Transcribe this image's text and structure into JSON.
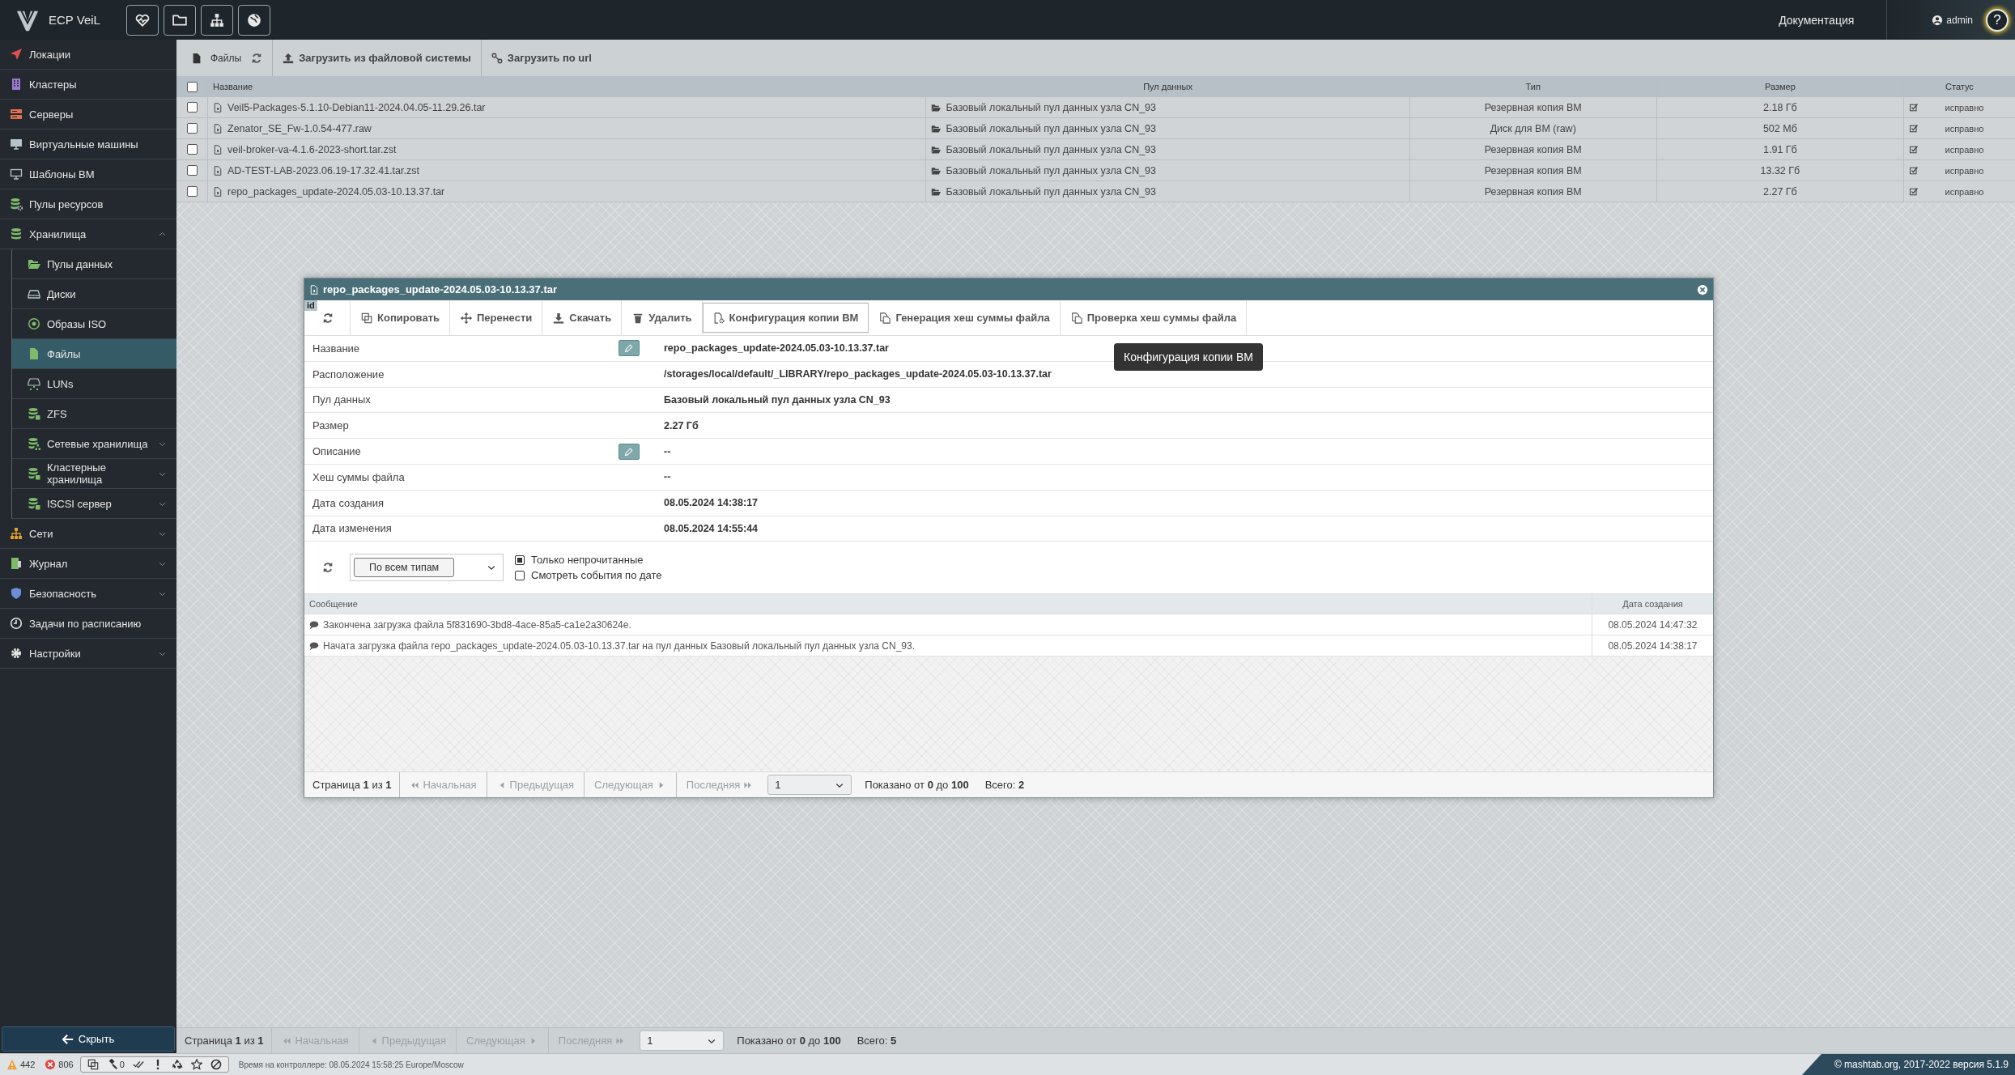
{
  "app": {
    "title": "ECP VeiL"
  },
  "top_buttons": [
    {
      "kind": "heart-pulse"
    },
    {
      "kind": "folder"
    },
    {
      "kind": "sitemap"
    },
    {
      "kind": "globe"
    }
  ],
  "header": {
    "docs_link": "Документация",
    "user": "admin",
    "help": "?"
  },
  "sidebar": {
    "items": [
      {
        "kind": "link",
        "label": "Локации",
        "selected": false
      },
      {
        "kind": "link",
        "label": "Кластеры",
        "selected": false
      },
      {
        "kind": "link",
        "label": "Серверы",
        "selected": false
      },
      {
        "kind": "link",
        "label": "Виртуальные машины",
        "selected": false
      },
      {
        "kind": "link",
        "label": "Шаблоны ВМ",
        "selected": false
      },
      {
        "kind": "link",
        "label": "Пулы ресурсов",
        "selected": false
      },
      {
        "kind": "group",
        "label": "Хранилища",
        "selected": false,
        "expanded": true,
        "children": [
          {
            "kind": "link",
            "label": "Пулы данных",
            "selected": false
          },
          {
            "kind": "link",
            "label": "Диски",
            "selected": false
          },
          {
            "kind": "link",
            "label": "Образы ISO",
            "selected": false
          },
          {
            "kind": "link",
            "label": "Файлы",
            "selected": true
          },
          {
            "kind": "link",
            "label": "LUNs",
            "selected": false
          },
          {
            "kind": "link",
            "label": "ZFS",
            "selected": false
          },
          {
            "kind": "group",
            "label": "Сетевые хранилища",
            "selected": false,
            "expanded": false
          },
          {
            "kind": "group",
            "label": "Кластерные хранилища",
            "selected": false,
            "expanded": false
          },
          {
            "kind": "group",
            "label": "ISCSI сервер",
            "selected": false,
            "expanded": false
          }
        ]
      },
      {
        "kind": "group",
        "label": "Сети",
        "selected": false,
        "expanded": false
      },
      {
        "kind": "group",
        "label": "Журнал",
        "selected": false,
        "expanded": false
      },
      {
        "kind": "group",
        "label": "Безопасность",
        "selected": false,
        "expanded": false
      },
      {
        "kind": "link",
        "label": "Задачи по расписанию",
        "selected": false
      },
      {
        "kind": "group",
        "label": "Настройки",
        "selected": false,
        "expanded": false
      }
    ],
    "hide_button": "Скрыть"
  },
  "toolbar": {
    "title": "Файлы",
    "buttons": [
      {
        "kind": "upload",
        "label": "Загрузить из файловой системы"
      },
      {
        "kind": "link",
        "label": "Загрузить по url"
      }
    ]
  },
  "table": {
    "all_checked": false,
    "columns": [
      "Название",
      "Пул данных",
      "Тип",
      "Размер",
      "Статус"
    ],
    "rows": [
      {
        "checked": false,
        "name": "Veil5-Packages-5.1.10-Debian11-2024.04.05-11.29.26.tar",
        "pool": "Базовый локальный пул данных узла CN_93",
        "type": "Резервная копия ВМ",
        "size": "2.18 Гб",
        "status": "исправно"
      },
      {
        "checked": false,
        "name": "Zenator_SE_Fw-1.0.54-477.raw",
        "pool": "Базовый локальный пул данных узла CN_93",
        "type": "Диск для ВМ (raw)",
        "size": "502 Мб",
        "status": "исправно"
      },
      {
        "checked": false,
        "name": "veil-broker-va-4.1.6-2023-short.tar.zst",
        "pool": "Базовый локальный пул данных узла CN_93",
        "type": "Резервная копия ВМ",
        "size": "1.91 Гб",
        "status": "исправно"
      },
      {
        "checked": false,
        "name": "AD-TEST-LAB-2023.06.19-17.32.41.tar.zst",
        "pool": "Базовый локальный пул данных узла CN_93",
        "type": "Резервная копия ВМ",
        "size": "13.32 Гб",
        "status": "исправно"
      },
      {
        "checked": false,
        "name": "repo_packages_update-2024.05.03-10.13.37.tar",
        "pool": "Базовый локальный пул данных узла CN_93",
        "type": "Резервная копия ВМ",
        "size": "2.27 Гб",
        "status": "исправно"
      }
    ]
  },
  "pagination": {
    "page_text": "Страница **1** из **1**",
    "buttons": [
      {
        "kind": "first",
        "label": "Начальная",
        "disabled": true
      },
      {
        "kind": "prev",
        "label": "Предыдущая",
        "disabled": true
      },
      {
        "kind": "next",
        "label": "Следующая",
        "disabled": true
      },
      {
        "kind": "last",
        "label": "Последняя",
        "disabled": true
      }
    ],
    "select": "1",
    "shown": "Показано от **0** до **100**",
    "total": "Всего: **5**"
  },
  "dialog": {
    "title": "repo_packages_update-2024.05.03-10.13.37.tar",
    "id_badge": "id",
    "actions": [
      {
        "kind": "refresh",
        "hovered": false
      },
      {
        "kind": "copy",
        "label": "Копировать",
        "hovered": false
      },
      {
        "kind": "move",
        "label": "Перенести",
        "hovered": false
      },
      {
        "kind": "download",
        "label": "Скачать",
        "hovered": false
      },
      {
        "kind": "trash",
        "label": "Удалить",
        "hovered": false
      },
      {
        "kind": "file-gear",
        "label": "Конфигурация копии ВМ",
        "hovered": true
      },
      {
        "kind": "file-copy",
        "label": "Генерация хеш суммы файла",
        "hovered": false
      },
      {
        "kind": "file-copy",
        "label": "Проверка хеш суммы файла",
        "hovered": false
      }
    ],
    "tooltip": "Конфигурация копии ВМ",
    "fields": [
      {
        "label": "Название",
        "value": "repo_packages_update-2024.05.03-10.13.37.tar",
        "editable": true
      },
      {
        "label": "Расположение",
        "value": "/storages/local/default/_LIBRARY/repo_packages_update-2024.05.03-10.13.37.tar",
        "editable": false
      },
      {
        "label": "Пул данных",
        "value": "Базовый локальный пул данных узла CN_93",
        "editable": false
      },
      {
        "label": "Размер",
        "value": "2.27 Гб",
        "editable": false
      },
      {
        "label": "Описание",
        "value": "--",
        "editable": true
      },
      {
        "label": "Хеш суммы файла",
        "value": "--",
        "editable": false
      },
      {
        "label": "Дата создания",
        "value": "08.05.2024 14:38:17",
        "editable": false
      },
      {
        "label": "Дата изменения",
        "value": "08.05.2024 14:55:44",
        "editable": false
      }
    ],
    "filter": {
      "select": "По всем типам",
      "checkboxes": [
        {
          "label": "Только непрочитанные",
          "checked": true
        },
        {
          "label": "Смотреть события по дате",
          "checked": false
        }
      ]
    },
    "events": {
      "columns": [
        "Сообщение",
        "Дата создания"
      ],
      "rows": [
        {
          "message": "Закончена загрузка файла 5f831690-3bd8-4ace-85a5-ca1e2a30624e.",
          "date": "08.05.2024 14:47:32"
        },
        {
          "message": "Начата загрузка файла repo_packages_update-2024.05.03-10.13.37.tar на пул данных Базовый локальный пул данных узла CN_93.",
          "date": "08.05.2024 14:38:17"
        }
      ]
    },
    "pagination": {
      "page_text": "Страница **1** из **1**",
      "buttons": [
        {
          "kind": "first",
          "label": "Начальная",
          "disabled": true
        },
        {
          "kind": "prev",
          "label": "Предыдущая",
          "disabled": true
        },
        {
          "kind": "next",
          "label": "Следующая",
          "disabled": true
        },
        {
          "kind": "last",
          "label": "Последняя",
          "disabled": true
        }
      ],
      "select": "1",
      "shown": "Показано от **0** до **100**",
      "total": "Всего: **2**"
    }
  },
  "status_bar": {
    "counters": [
      {
        "kind": "warning",
        "count": "442"
      },
      {
        "kind": "error",
        "count": "806"
      }
    ],
    "tools": [
      {
        "kind": "copy"
      },
      {
        "kind": "gavel",
        "count": "0"
      },
      {
        "kind": "double-check"
      },
      {
        "kind": "exclamation"
      },
      {
        "kind": "recycle"
      },
      {
        "kind": "star"
      },
      {
        "kind": "ban"
      }
    ],
    "server_time": "Время на контроллере: 08.05.2024 15:58:25 Europe/Moscow",
    "copyright": "© mashtab.org, 2017-2022 версия 5.1.9"
  }
}
